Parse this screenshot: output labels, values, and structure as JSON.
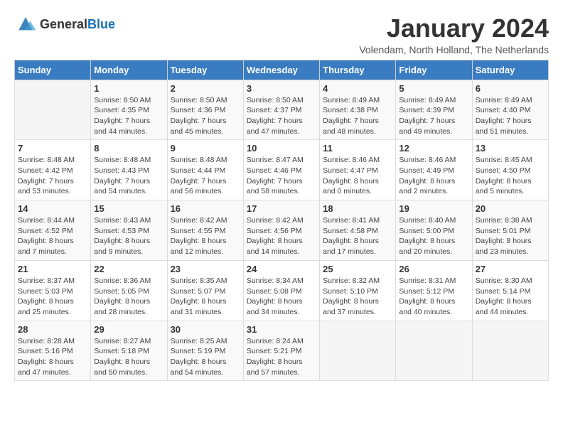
{
  "header": {
    "logo": {
      "general": "General",
      "blue": "Blue"
    },
    "month": "January 2024",
    "location": "Volendam, North Holland, The Netherlands"
  },
  "weekdays": [
    "Sunday",
    "Monday",
    "Tuesday",
    "Wednesday",
    "Thursday",
    "Friday",
    "Saturday"
  ],
  "weeks": [
    [
      {
        "day": null
      },
      {
        "day": "1",
        "sunrise": "Sunrise: 8:50 AM",
        "sunset": "Sunset: 4:35 PM",
        "daylight": "Daylight: 7 hours and 44 minutes."
      },
      {
        "day": "2",
        "sunrise": "Sunrise: 8:50 AM",
        "sunset": "Sunset: 4:36 PM",
        "daylight": "Daylight: 7 hours and 45 minutes."
      },
      {
        "day": "3",
        "sunrise": "Sunrise: 8:50 AM",
        "sunset": "Sunset: 4:37 PM",
        "daylight": "Daylight: 7 hours and 47 minutes."
      },
      {
        "day": "4",
        "sunrise": "Sunrise: 8:49 AM",
        "sunset": "Sunset: 4:38 PM",
        "daylight": "Daylight: 7 hours and 48 minutes."
      },
      {
        "day": "5",
        "sunrise": "Sunrise: 8:49 AM",
        "sunset": "Sunset: 4:39 PM",
        "daylight": "Daylight: 7 hours and 49 minutes."
      },
      {
        "day": "6",
        "sunrise": "Sunrise: 8:49 AM",
        "sunset": "Sunset: 4:40 PM",
        "daylight": "Daylight: 7 hours and 51 minutes."
      }
    ],
    [
      {
        "day": "7",
        "sunrise": "Sunrise: 8:48 AM",
        "sunset": "Sunset: 4:42 PM",
        "daylight": "Daylight: 7 hours and 53 minutes."
      },
      {
        "day": "8",
        "sunrise": "Sunrise: 8:48 AM",
        "sunset": "Sunset: 4:43 PM",
        "daylight": "Daylight: 7 hours and 54 minutes."
      },
      {
        "day": "9",
        "sunrise": "Sunrise: 8:48 AM",
        "sunset": "Sunset: 4:44 PM",
        "daylight": "Daylight: 7 hours and 56 minutes."
      },
      {
        "day": "10",
        "sunrise": "Sunrise: 8:47 AM",
        "sunset": "Sunset: 4:46 PM",
        "daylight": "Daylight: 7 hours and 58 minutes."
      },
      {
        "day": "11",
        "sunrise": "Sunrise: 8:46 AM",
        "sunset": "Sunset: 4:47 PM",
        "daylight": "Daylight: 8 hours and 0 minutes."
      },
      {
        "day": "12",
        "sunrise": "Sunrise: 8:46 AM",
        "sunset": "Sunset: 4:49 PM",
        "daylight": "Daylight: 8 hours and 2 minutes."
      },
      {
        "day": "13",
        "sunrise": "Sunrise: 8:45 AM",
        "sunset": "Sunset: 4:50 PM",
        "daylight": "Daylight: 8 hours and 5 minutes."
      }
    ],
    [
      {
        "day": "14",
        "sunrise": "Sunrise: 8:44 AM",
        "sunset": "Sunset: 4:52 PM",
        "daylight": "Daylight: 8 hours and 7 minutes."
      },
      {
        "day": "15",
        "sunrise": "Sunrise: 8:43 AM",
        "sunset": "Sunset: 4:53 PM",
        "daylight": "Daylight: 8 hours and 9 minutes."
      },
      {
        "day": "16",
        "sunrise": "Sunrise: 8:42 AM",
        "sunset": "Sunset: 4:55 PM",
        "daylight": "Daylight: 8 hours and 12 minutes."
      },
      {
        "day": "17",
        "sunrise": "Sunrise: 8:42 AM",
        "sunset": "Sunset: 4:56 PM",
        "daylight": "Daylight: 8 hours and 14 minutes."
      },
      {
        "day": "18",
        "sunrise": "Sunrise: 8:41 AM",
        "sunset": "Sunset: 4:58 PM",
        "daylight": "Daylight: 8 hours and 17 minutes."
      },
      {
        "day": "19",
        "sunrise": "Sunrise: 8:40 AM",
        "sunset": "Sunset: 5:00 PM",
        "daylight": "Daylight: 8 hours and 20 minutes."
      },
      {
        "day": "20",
        "sunrise": "Sunrise: 8:38 AM",
        "sunset": "Sunset: 5:01 PM",
        "daylight": "Daylight: 8 hours and 23 minutes."
      }
    ],
    [
      {
        "day": "21",
        "sunrise": "Sunrise: 8:37 AM",
        "sunset": "Sunset: 5:03 PM",
        "daylight": "Daylight: 8 hours and 25 minutes."
      },
      {
        "day": "22",
        "sunrise": "Sunrise: 8:36 AM",
        "sunset": "Sunset: 5:05 PM",
        "daylight": "Daylight: 8 hours and 28 minutes."
      },
      {
        "day": "23",
        "sunrise": "Sunrise: 8:35 AM",
        "sunset": "Sunset: 5:07 PM",
        "daylight": "Daylight: 8 hours and 31 minutes."
      },
      {
        "day": "24",
        "sunrise": "Sunrise: 8:34 AM",
        "sunset": "Sunset: 5:08 PM",
        "daylight": "Daylight: 8 hours and 34 minutes."
      },
      {
        "day": "25",
        "sunrise": "Sunrise: 8:32 AM",
        "sunset": "Sunset: 5:10 PM",
        "daylight": "Daylight: 8 hours and 37 minutes."
      },
      {
        "day": "26",
        "sunrise": "Sunrise: 8:31 AM",
        "sunset": "Sunset: 5:12 PM",
        "daylight": "Daylight: 8 hours and 40 minutes."
      },
      {
        "day": "27",
        "sunrise": "Sunrise: 8:30 AM",
        "sunset": "Sunset: 5:14 PM",
        "daylight": "Daylight: 8 hours and 44 minutes."
      }
    ],
    [
      {
        "day": "28",
        "sunrise": "Sunrise: 8:28 AM",
        "sunset": "Sunset: 5:16 PM",
        "daylight": "Daylight: 8 hours and 47 minutes."
      },
      {
        "day": "29",
        "sunrise": "Sunrise: 8:27 AM",
        "sunset": "Sunset: 5:18 PM",
        "daylight": "Daylight: 8 hours and 50 minutes."
      },
      {
        "day": "30",
        "sunrise": "Sunrise: 8:25 AM",
        "sunset": "Sunset: 5:19 PM",
        "daylight": "Daylight: 8 hours and 54 minutes."
      },
      {
        "day": "31",
        "sunrise": "Sunrise: 8:24 AM",
        "sunset": "Sunset: 5:21 PM",
        "daylight": "Daylight: 8 hours and 57 minutes."
      },
      {
        "day": null
      },
      {
        "day": null
      },
      {
        "day": null
      }
    ]
  ]
}
